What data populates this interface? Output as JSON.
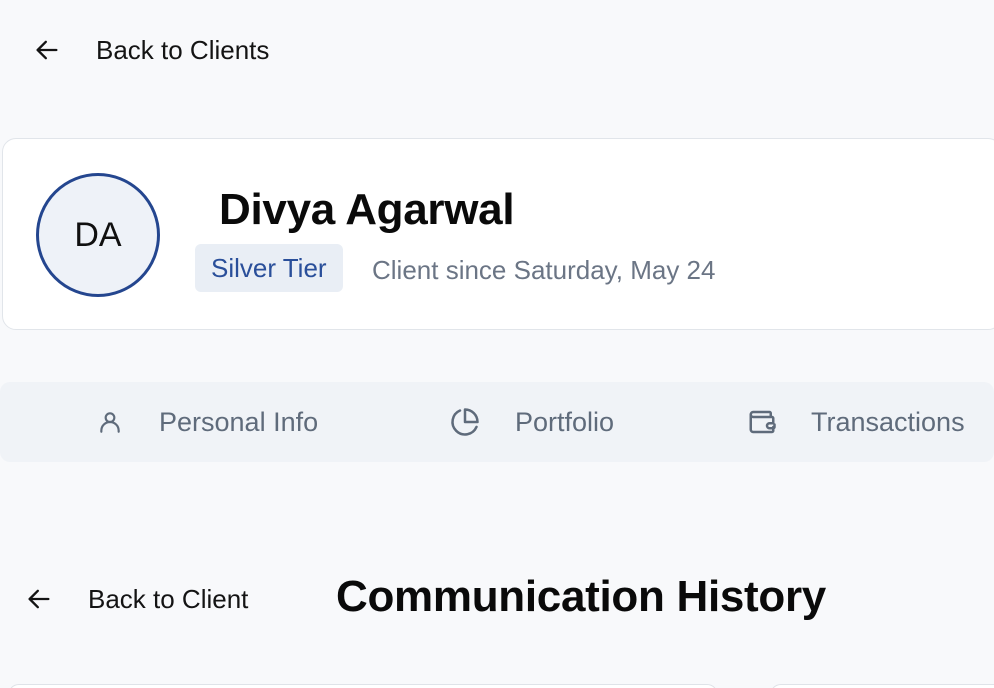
{
  "nav": {
    "back_to_clients": "Back to Clients"
  },
  "client": {
    "initials": "DA",
    "name": "Divya Agarwal",
    "tier": "Silver Tier",
    "since": "Client since Saturday, May 24"
  },
  "tabs": [
    {
      "label": "Personal Info",
      "icon": "user-icon"
    },
    {
      "label": "Portfolio",
      "icon": "pie-chart-icon"
    },
    {
      "label": "Transactions",
      "icon": "wallet-icon"
    }
  ],
  "communication": {
    "back_to_client": "Back to Client",
    "title": "Communication History"
  },
  "colors": {
    "accent": "#24468f",
    "tier_text": "#2a4f9a",
    "tier_bg": "#e9eef5",
    "muted": "#6b7585",
    "background": "#f8f9fb"
  }
}
